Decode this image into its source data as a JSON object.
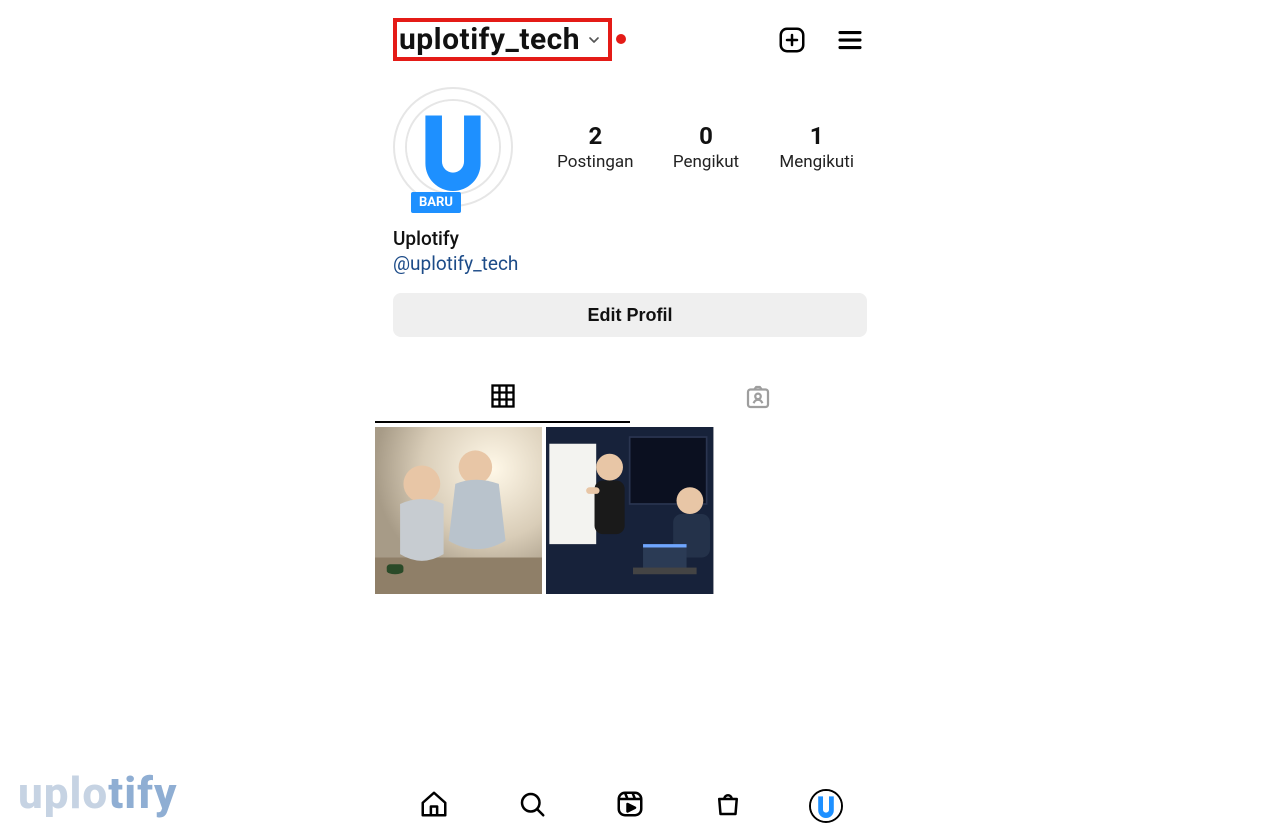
{
  "header": {
    "username": "uplotify_tech"
  },
  "profile": {
    "badge": "BARU",
    "display_name": "Uplotify",
    "handle": "@uplotify_tech",
    "edit_button": "Edit Profil",
    "stats": {
      "posts_count": "2",
      "posts_label": "Postingan",
      "followers_count": "0",
      "followers_label": "Pengikut",
      "following_count": "1",
      "following_label": "Mengikuti"
    }
  },
  "watermark": {
    "part1": "uplo",
    "part2": "tify"
  }
}
